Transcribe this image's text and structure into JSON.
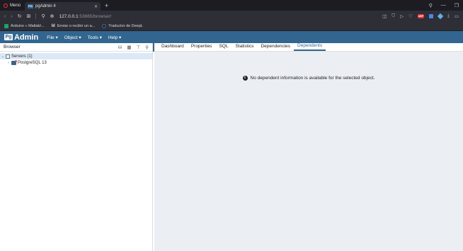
{
  "browser": {
    "menu_label": "Menú",
    "tab_title": "pgAdmin 4",
    "tab_favicon_text": "PG",
    "new_tab_glyph": "+",
    "url_host": "127.0.0.1",
    "url_rest": ":53665/browser/",
    "bookmarks": [
      {
        "label": "Arduino » Matlab/...",
        "icon": "green-square-icon"
      },
      {
        "label": "Enviar o recibir un a...",
        "icon": "bars-icon"
      },
      {
        "label": "Traductor de DeepL",
        "icon": "deepl-icon"
      }
    ],
    "adblock_text": "ABP"
  },
  "pgadmin": {
    "brand_pg": "Pg",
    "brand_name": "Admin",
    "menu": [
      {
        "label": "File ▾"
      },
      {
        "label": "Object ▾"
      },
      {
        "label": "Tools ▾"
      },
      {
        "label": "Help ▾"
      }
    ]
  },
  "browser_panel": {
    "title": "Browser",
    "tree": [
      {
        "label": "Servers (1)",
        "chevron": "⌄"
      },
      {
        "label": "PostgreSQL 13",
        "chevron": "›"
      }
    ]
  },
  "main_tabs": [
    {
      "label": "Dashboard"
    },
    {
      "label": "Properties"
    },
    {
      "label": "SQL"
    },
    {
      "label": "Statistics"
    },
    {
      "label": "Dependencies"
    },
    {
      "label": "Dependents"
    }
  ],
  "active_tab": "Dependents",
  "content": {
    "info_message": "No dependent information is available for the selected object."
  },
  "colors": {
    "pgadmin_blue": "#326690",
    "content_bg": "#ebeef3",
    "browser_chrome": "#2e2e36"
  }
}
